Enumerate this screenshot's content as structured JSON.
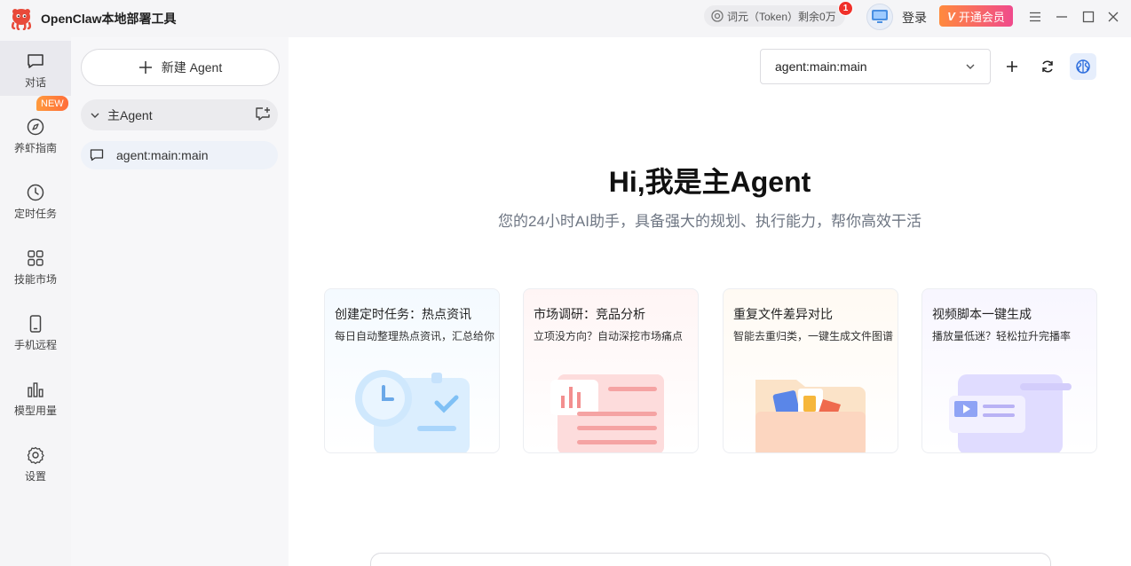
{
  "app": {
    "title": "OpenClaw本地部署工具"
  },
  "titlebar": {
    "token_label": "词元（Token）剩余0万",
    "notification_count": "1",
    "login_label": "登录",
    "vip_label": "开通会员",
    "vip_badge": "V"
  },
  "nav": {
    "items": [
      {
        "label": "对话",
        "icon": "chat-icon"
      },
      {
        "label": "养虾指南",
        "icon": "compass-icon"
      },
      {
        "label": "定时任务",
        "icon": "clock-icon"
      },
      {
        "label": "技能市场",
        "icon": "grid-icon"
      },
      {
        "label": "手机远程",
        "icon": "phone-icon"
      },
      {
        "label": "模型用量",
        "icon": "bar-chart-icon"
      },
      {
        "label": "设置",
        "icon": "gear-icon"
      }
    ],
    "new_tag": "NEW"
  },
  "sidebar": {
    "new_agent_label": "新建 Agent",
    "group_label": "主Agent",
    "session_label": "agent:main:main"
  },
  "main": {
    "agent_select_value": "agent:main:main",
    "hero_title": "Hi,我是主Agent",
    "hero_subtitle": "您的24小时AI助手，具备强大的规划、执行能力，帮你高效干活",
    "cards": [
      {
        "title": "创建定时任务：热点资讯",
        "desc": "每日自动整理热点资讯，汇总给你"
      },
      {
        "title": "市场调研：竞品分析",
        "desc": "立项没方向？自动深挖市场痛点"
      },
      {
        "title": "重复文件差异对比",
        "desc": "智能去重归类，一键生成文件图谱"
      },
      {
        "title": "视频脚本一键生成",
        "desc": "播放量低迷？轻松拉升完播率"
      }
    ]
  },
  "colors": {
    "accent": "#2f6fde",
    "vip_start": "#ff8a3d",
    "vip_end": "#f04a8c",
    "badge": "#f0302a"
  }
}
